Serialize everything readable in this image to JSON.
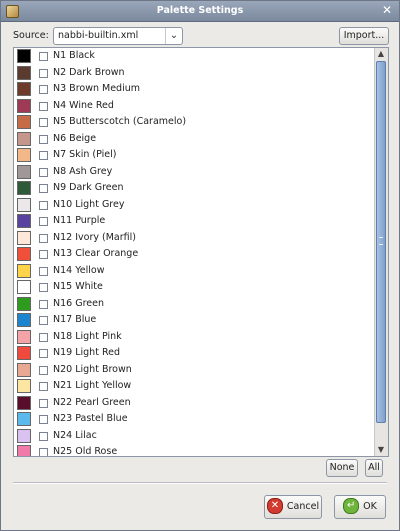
{
  "window": {
    "title": "Palette Settings"
  },
  "source": {
    "label": "Source:",
    "value": "nabbi-builtin.xml"
  },
  "buttons": {
    "import": "Import...",
    "none": "None",
    "all": "All",
    "cancel": "Cancel",
    "ok": "OK"
  },
  "palette": [
    {
      "label": "N1 Black",
      "color": "#000000"
    },
    {
      "label": "N2 Dark Brown",
      "color": "#5b3a2f"
    },
    {
      "label": "N3 Brown Medium",
      "color": "#6d3b2a"
    },
    {
      "label": "N4 Wine Red",
      "color": "#9e3a55"
    },
    {
      "label": "N5 Butterscotch (Caramelo)",
      "color": "#c56b45"
    },
    {
      "label": "N6 Beige",
      "color": "#c4968c"
    },
    {
      "label": "N7 Skin (Piel)",
      "color": "#f3b88a"
    },
    {
      "label": "N8 Ash Grey",
      "color": "#a09898"
    },
    {
      "label": "N9 Dark Green",
      "color": "#2e5a3a"
    },
    {
      "label": "N10 Light Grey",
      "color": "#ece8ea"
    },
    {
      "label": "N11 Purple",
      "color": "#5844a0"
    },
    {
      "label": "N12 Ivory (Marfil)",
      "color": "#fde8da"
    },
    {
      "label": "N13 Clear Orange",
      "color": "#f0503a"
    },
    {
      "label": "N14 Yellow",
      "color": "#fdd34a"
    },
    {
      "label": "N15 White",
      "color": "#ffffff"
    },
    {
      "label": "N16 Green",
      "color": "#2e9a1e"
    },
    {
      "label": "N17 Blue",
      "color": "#1b86cf"
    },
    {
      "label": "N18 Light Pink",
      "color": "#f4a3a8"
    },
    {
      "label": "N19 Light Red",
      "color": "#f04a3e"
    },
    {
      "label": "N20 Light Brown",
      "color": "#e8a892"
    },
    {
      "label": "N21 Light Yellow",
      "color": "#fbe5a0"
    },
    {
      "label": "N22 Pearl Green",
      "color": "#5a0d2a"
    },
    {
      "label": "N23 Pastel Blue",
      "color": "#5ab8ec"
    },
    {
      "label": "N24 Lilac",
      "color": "#d9c2ef"
    },
    {
      "label": "N25 Old Rose",
      "color": "#f07aa8"
    }
  ]
}
